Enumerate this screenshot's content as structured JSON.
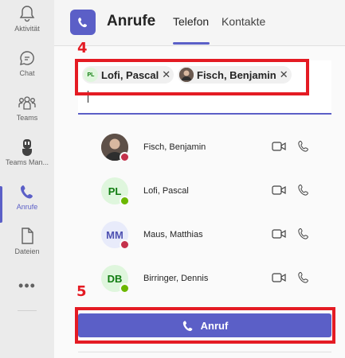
{
  "rail": {
    "items": [
      {
        "label": "Aktivität",
        "icon": "bell-icon"
      },
      {
        "label": "Chat",
        "icon": "chat-icon"
      },
      {
        "label": "Teams",
        "icon": "teams-icon"
      },
      {
        "label": "Teams Man...",
        "icon": "teams-manager-icon"
      },
      {
        "label": "Anrufe",
        "icon": "phone-icon",
        "active": true
      },
      {
        "label": "Dateien",
        "icon": "file-icon"
      }
    ],
    "more": "•••"
  },
  "header": {
    "title": "Anrufe",
    "tabs": [
      {
        "label": "Telefon",
        "active": true
      },
      {
        "label": "Kontakte",
        "active": false
      }
    ]
  },
  "steps": {
    "picker": "4",
    "call": "5"
  },
  "picker": {
    "chips": [
      {
        "initials": "PL",
        "name": "Lofi, Pascal"
      },
      {
        "name": "Fisch, Benjamin",
        "photo": true
      }
    ],
    "remove_glyph": "✕"
  },
  "contacts": [
    {
      "name": "Fisch, Benjamin",
      "initials": "",
      "photo": true,
      "status": "busy"
    },
    {
      "name": "Lofi, Pascal",
      "initials": "PL",
      "status": "available"
    },
    {
      "name": "Maus, Matthias",
      "initials": "MM",
      "status": "busy"
    },
    {
      "name": "Birringer, Dennis",
      "initials": "DB",
      "status": "available"
    }
  ],
  "call_button": {
    "label": "Anruf"
  },
  "colors": {
    "accent": "#5b5fc7",
    "highlight": "#e41b23",
    "busy": "#c4314b",
    "available": "#6bb700"
  }
}
